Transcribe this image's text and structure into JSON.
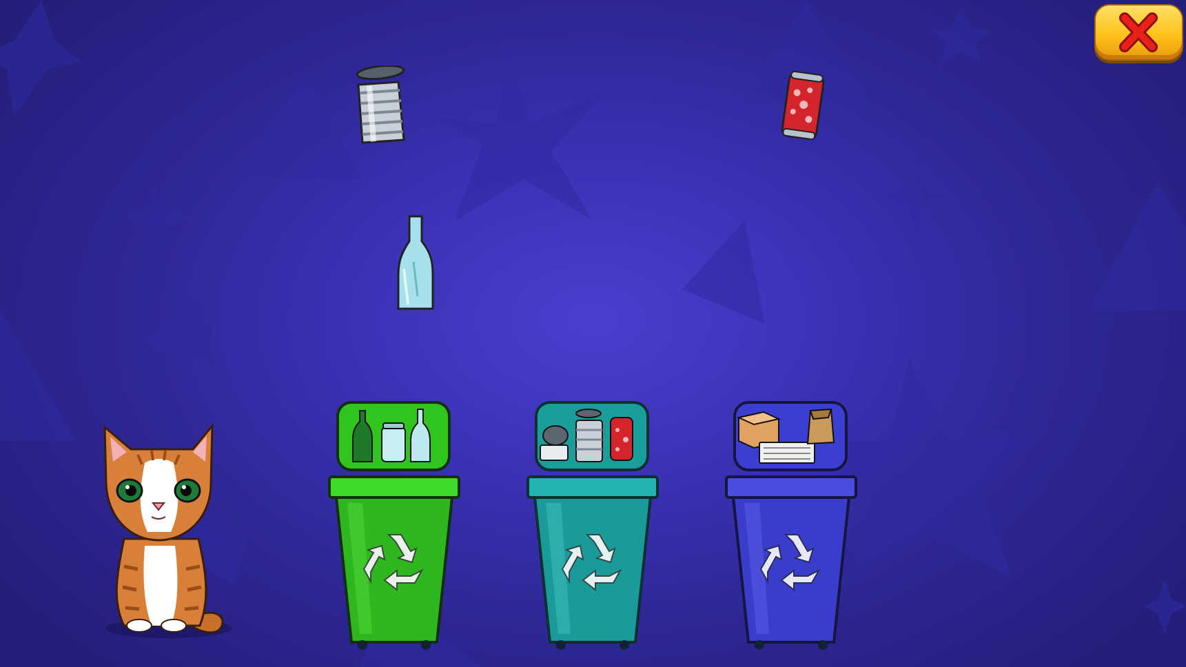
{
  "game": {
    "title": "",
    "scene": "recycling-sort"
  },
  "close_button": {
    "icon": "close-icon",
    "color": "#e8201a"
  },
  "falling_items": [
    {
      "name": "tin-can",
      "category": "metal"
    },
    {
      "name": "soda-can",
      "category": "metal"
    },
    {
      "name": "glass-bottle",
      "category": "glass"
    }
  ],
  "bins": [
    {
      "name": "glass-bin",
      "color": "#2fc41e",
      "contents": [
        "green-bottle",
        "glass-jar",
        "clear-bottle"
      ]
    },
    {
      "name": "metal-bin",
      "color": "#1a9e9c",
      "contents": [
        "fish-tin",
        "tin-can",
        "soda-can"
      ]
    },
    {
      "name": "paper-bin",
      "color": "#3b3ed0",
      "contents": [
        "cardboard-box",
        "newspapers",
        "paper-bag"
      ]
    }
  ],
  "mascot": {
    "name": "kitten"
  },
  "colors": {
    "background": "#3a31b4",
    "bin_green": "#2fc41e",
    "bin_teal": "#1a9e9c",
    "bin_blue": "#3b3ed0",
    "close_yellow": "#ffc21a"
  }
}
